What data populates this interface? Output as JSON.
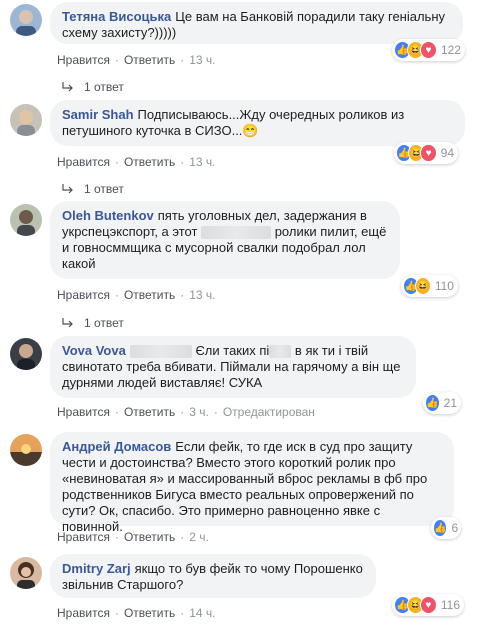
{
  "comments": [
    {
      "author": "Тетяна Висоцька",
      "text": "Це вам на Банковій порадили таку геніальну схему захисту?)))))",
      "like": "Нравится",
      "reply": "Ответить",
      "time": "13 ч.",
      "reactions": [
        "like",
        "haha",
        "love"
      ],
      "reaction_count": "122",
      "replies": "1 ответ"
    },
    {
      "author": "Samir Shah",
      "text": "Подписываюсь...Жду очередных роликов из петушиного куточка в СИЗО...😁",
      "like": "Нравится",
      "reply": "Ответить",
      "time": "13 ч.",
      "reactions": [
        "like",
        "haha",
        "love"
      ],
      "reaction_count": "94",
      "replies": "1 ответ"
    },
    {
      "author": "Oleh Butenkov",
      "text_a": "пять уголовных дел, задержания в укрспецэкспорт, а этот",
      "text_b": "ролики пилит, ещё и говносммщика с мусорной свалки подобрал лол какой",
      "like": "Нравится",
      "reply": "Ответить",
      "time": "13 ч.",
      "reactions": [
        "like",
        "haha"
      ],
      "reaction_count": "110",
      "replies": "1 ответ"
    },
    {
      "author": "Vova Vova",
      "text_a": "Єли таких пі",
      "text_b": "в як ти і твій свинотато треба вбивати. Піймали на гарячому а він ще дурнями людей виставляє! СУКА",
      "like": "Нравится",
      "reply": "Ответить",
      "time": "3 ч.",
      "edited": "Отредактирован",
      "reactions": [
        "like"
      ],
      "reaction_count": "21"
    },
    {
      "author": "Андрей Домасов",
      "text": "Если фейк, то где иск в суд про защиту чести и достоинства? Вместо этого короткий ролик про «невиноватая я» и массированный вброс рекламы в фб про родственников Бигуса вместо реальных опровержений по сути? Ок, спасибо. Это примерно равноценно явке с повинной.",
      "like": "Нравится",
      "reply": "Ответить",
      "time": "2 ч.",
      "reactions": [
        "like"
      ],
      "reaction_count": "6"
    },
    {
      "author": "Dmitry Zarj",
      "text": "якщо то був фейк то чому Порошенко звільнив Старшого?",
      "like": "Нравится",
      "reply": "Ответить",
      "time": "14 ч.",
      "reactions": [
        "like",
        "haha",
        "love"
      ],
      "reaction_count": "116"
    }
  ],
  "colors": {
    "link": "#385898",
    "bubble": "#f2f3f5",
    "meta": "#90949c"
  }
}
